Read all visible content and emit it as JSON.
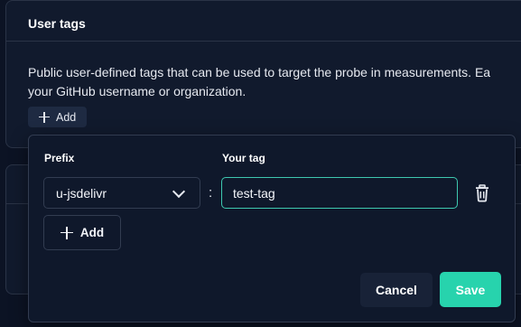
{
  "section": {
    "title": "User tags",
    "description_line1": "Public user-defined tags that can be used to target the probe in measurements. Ea",
    "description_line2": "your GitHub username or organization.",
    "add_label": "Add"
  },
  "popover": {
    "prefix_label": "Prefix",
    "tag_label": "Your tag",
    "prefix_value": "u-jsdelivr",
    "separator": ":",
    "tag_value": "test-tag",
    "add_label": "Add",
    "cancel_label": "Cancel",
    "save_label": "Save"
  },
  "icons": {
    "plus": "plus-icon",
    "chevron": "chevron-down-icon",
    "trash": "trash-icon"
  },
  "colors": {
    "background": "#0c1324",
    "accent": "#27d3ad",
    "focus_border": "#3ec8b0"
  }
}
